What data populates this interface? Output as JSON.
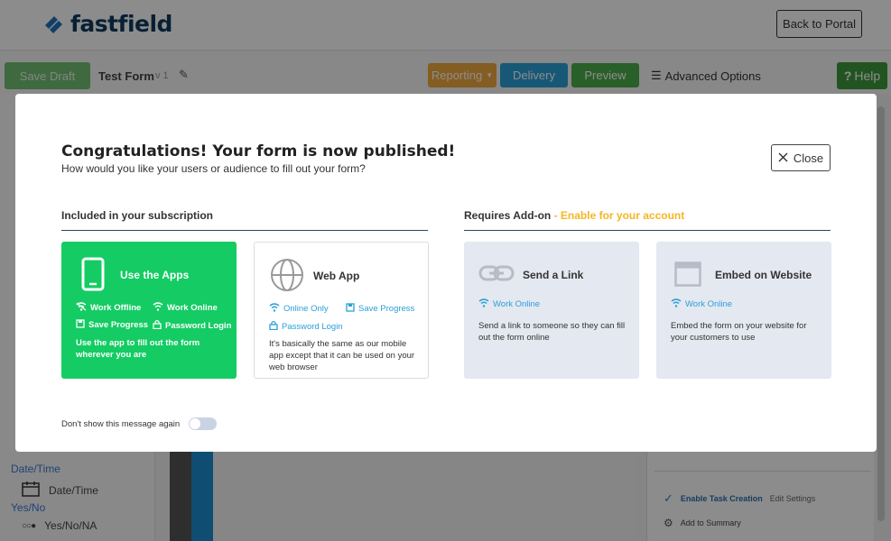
{
  "app": {
    "logo_text": "fastfield",
    "back_to_portal": "Back to Portal"
  },
  "toolbar": {
    "save_draft": "Save Draft",
    "form_name": "Test Form",
    "form_version": "v 1",
    "reporting": "Reporting",
    "delivery": "Delivery",
    "preview": "Preview",
    "advanced_options": "Advanced Options",
    "help": "Help"
  },
  "left_panel": {
    "category_datetime": "Date/Time",
    "item_datetime": "Date/Time",
    "category_yesno": "Yes/No",
    "item_yesno": "Yes/No/NA"
  },
  "right_panel": {
    "enable_task_creation": "Enable Task Creation",
    "edit_settings": "Edit Settings",
    "add_to_summary": "Add to Summary"
  },
  "modal": {
    "title": "Congratulations! Your form is now published!",
    "subtitle": "How would you like your users or audience to fill out your form?",
    "close_label": "Close",
    "included_heading": "Included in your subscription",
    "addon_heading": "Requires Add-on",
    "addon_link": " - Enable for your account",
    "dont_show": "Don't show this message again",
    "dont_show_enabled": false,
    "cards": {
      "apps": {
        "title": "Use the Apps",
        "features": [
          "Work Offline",
          "Work Online",
          "Save Progress",
          "Password Login"
        ],
        "description": "Use the app to fill out the form wherever you are"
      },
      "web": {
        "title": "Web App",
        "features": [
          "Online Only",
          "Save Progress",
          "Password Login"
        ],
        "description": "It's basically the same as our mobile app except that it can be used on your web browser"
      },
      "link": {
        "title": "Send a Link",
        "features": [
          "Work Online"
        ],
        "description": "Send a link to someone so they can fill out the form online"
      },
      "embed": {
        "title": "Embed on Website",
        "features": [
          "Work Online"
        ],
        "description": "Embed the form on your website for your customers to use"
      }
    }
  },
  "colors": {
    "green_card": "#14cc63",
    "addon_yellow": "#f5b523",
    "feature_blue": "#2aa0d8",
    "gray_card": "#e4e8f0"
  }
}
